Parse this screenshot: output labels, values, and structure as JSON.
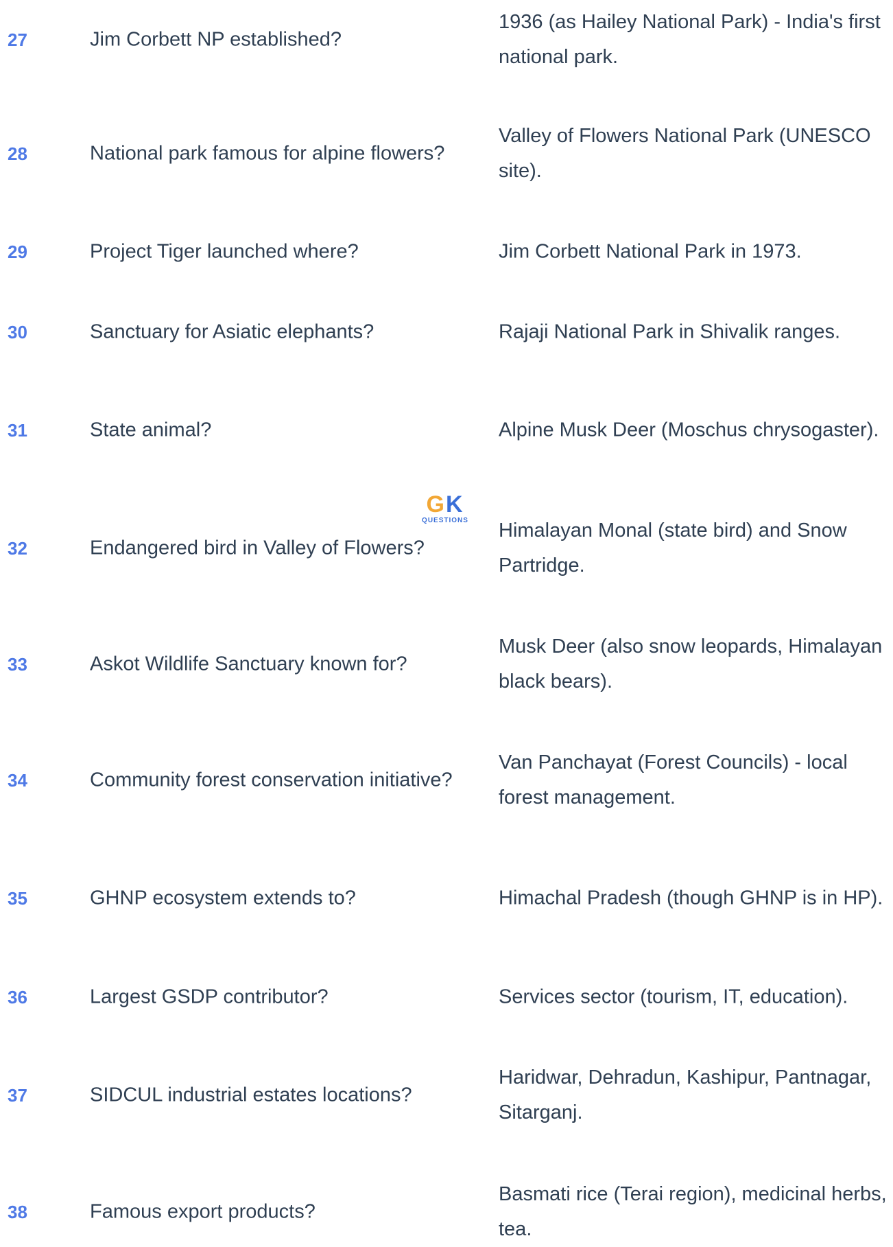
{
  "rows": [
    {
      "num": "27",
      "question": "Jim Corbett NP established?",
      "answer": "1936 (as Hailey National Park) - India's first national park."
    },
    {
      "num": "28",
      "question": "National park famous for alpine flowers?",
      "answer": "Valley of Flowers National Park (UNESCO site)."
    },
    {
      "num": "29",
      "question": "Project Tiger launched where?",
      "answer": "Jim Corbett National Park in 1973."
    },
    {
      "num": "30",
      "question": "Sanctuary for Asiatic elephants?",
      "answer": "Rajaji National Park in Shivalik ranges."
    },
    {
      "num": "31",
      "question": "State animal?",
      "answer": "Alpine Musk Deer (Moschus chrysogaster)."
    },
    {
      "num": "32",
      "question": "Endangered bird in Valley of Flowers?",
      "answer": "Himalayan Monal (state bird) and Snow Partridge."
    },
    {
      "num": "33",
      "question": "Askot Wildlife Sanctuary known for?",
      "answer": "Musk Deer (also snow leopards, Himalayan black bears)."
    },
    {
      "num": "34",
      "question": "Community forest conservation initiative?",
      "answer": "Van Panchayat (Forest Councils) - local forest management."
    },
    {
      "num": "35",
      "question": "GHNP ecosystem extends to?",
      "answer": "Himachal Pradesh (though GHNP is in HP)."
    },
    {
      "num": "36",
      "question": "Largest GSDP contributor?",
      "answer": "Services sector (tourism, IT, education)."
    },
    {
      "num": "37",
      "question": "SIDCUL industrial estates locations?",
      "answer": "Haridwar, Dehradun, Kashipur, Pantnagar, Sitarganj."
    },
    {
      "num": "38",
      "question": "Famous export products?",
      "answer": "Basmati rice (Terai region), medicinal herbs, tea."
    }
  ],
  "watermark": {
    "logo_g": "G",
    "logo_k": "K",
    "subtitle": "QUESTIONS"
  },
  "colors": {
    "number": "#4e79e6",
    "text": "#2f3f52",
    "logo_orange": "#f2a735",
    "logo_blue": "#3a6fd8"
  }
}
